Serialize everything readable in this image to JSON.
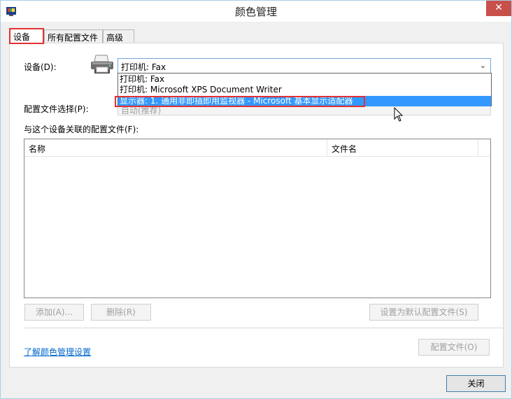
{
  "window": {
    "title": "颜色管理",
    "close_symbol": "✕"
  },
  "tabs": [
    {
      "label": "设备",
      "active": true
    },
    {
      "label": "所有配置文件",
      "active": false
    },
    {
      "label": "高级",
      "active": false
    }
  ],
  "device": {
    "label": "设备(D):",
    "selected_value": "打印机: Fax",
    "options": [
      "打印机: Fax",
      "打印机: Microsoft XPS Document Writer",
      "显示器: 1. 通用非即插即用监视器 - Microsoft 基本显示适配器"
    ],
    "highlighted_option_index": 2
  },
  "profile_selection": {
    "label": "配置文件选择(P):",
    "value": "自动(推荐)"
  },
  "profiles_list": {
    "label": "与这个设备关联的配置文件(F):",
    "columns": [
      "名称",
      "文件名"
    ],
    "rows": []
  },
  "buttons": {
    "add": "添加(A)...",
    "remove": "删除(R)",
    "set_default": "设置为默认配置文件(S)",
    "profiles": "配置文件(O)",
    "close": "关闭"
  },
  "link_text": "了解颜色管理设置",
  "colors": {
    "accent": "#3399ff",
    "annotation_red": "#e23232",
    "link": "#0066cc",
    "close_button": "#c7514a"
  }
}
